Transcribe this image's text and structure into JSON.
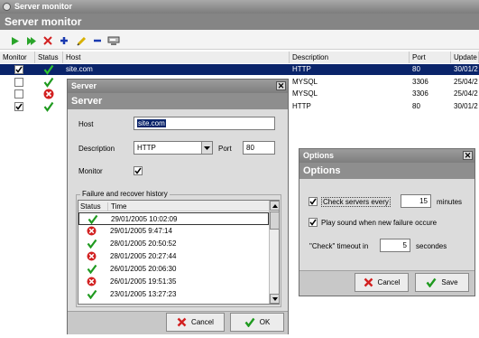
{
  "app": {
    "window_title": "Server monitor",
    "header_title": "Server monitor"
  },
  "toolbar": {
    "icons": [
      "play-icon",
      "play-all-icon",
      "delete-icon",
      "add-icon",
      "edit-icon",
      "remove-icon",
      "server-icon"
    ]
  },
  "table": {
    "columns": [
      "Monitor",
      "Status",
      "Host",
      "Description",
      "Port",
      "Update"
    ],
    "rows": [
      {
        "monitor": true,
        "status": "ok",
        "host": "site.com",
        "description": "HTTP",
        "port": "80",
        "update": "30/01/2"
      },
      {
        "monitor": false,
        "status": "ok",
        "host": "",
        "description": "MYSQL",
        "port": "3306",
        "update": "25/04/2"
      },
      {
        "monitor": false,
        "status": "error",
        "host": "",
        "description": "MYSQL",
        "port": "3306",
        "update": "25/04/2"
      },
      {
        "monitor": true,
        "status": "ok",
        "host": "",
        "description": "HTTP",
        "port": "80",
        "update": "30/01/2"
      }
    ]
  },
  "server_dialog": {
    "title": "Server",
    "header": "Server",
    "host_label": "Host",
    "host_value": "site.com",
    "description_label": "Description",
    "description_value": "HTTP",
    "port_label": "Port",
    "port_value": "80",
    "monitor_label": "Monitor",
    "monitor_checked": true,
    "history_label": "Failure and recover history",
    "history_columns": [
      "Status",
      "Time"
    ],
    "history": [
      {
        "status": "ok",
        "time": "29/01/2005 10:02:09"
      },
      {
        "status": "error",
        "time": "29/01/2005 9:47:14"
      },
      {
        "status": "ok",
        "time": "28/01/2005 20:50:52"
      },
      {
        "status": "error",
        "time": "28/01/2005 20:27:44"
      },
      {
        "status": "ok",
        "time": "26/01/2005 20:06:30"
      },
      {
        "status": "error",
        "time": "26/01/2005 19:51:35"
      },
      {
        "status": "ok",
        "time": "23/01/2005 13:27:23"
      }
    ],
    "cancel_label": "Cancel",
    "ok_label": "OK"
  },
  "options_dialog": {
    "title": "Options",
    "header": "Options",
    "check_every_label": "Check servers every",
    "check_every_checked": true,
    "check_every_value": "15",
    "check_every_unit": "minutes",
    "play_sound_label": "Play sound when new failure occure",
    "play_sound_checked": true,
    "timeout_label": "\"Check\" timeout in",
    "timeout_value": "5",
    "timeout_unit": "secondes",
    "cancel_label": "Cancel",
    "save_label": "Save"
  },
  "colors": {
    "selected_row": "#0a246a",
    "ok_green": "#1f9a1f",
    "error_red": "#d22020"
  }
}
